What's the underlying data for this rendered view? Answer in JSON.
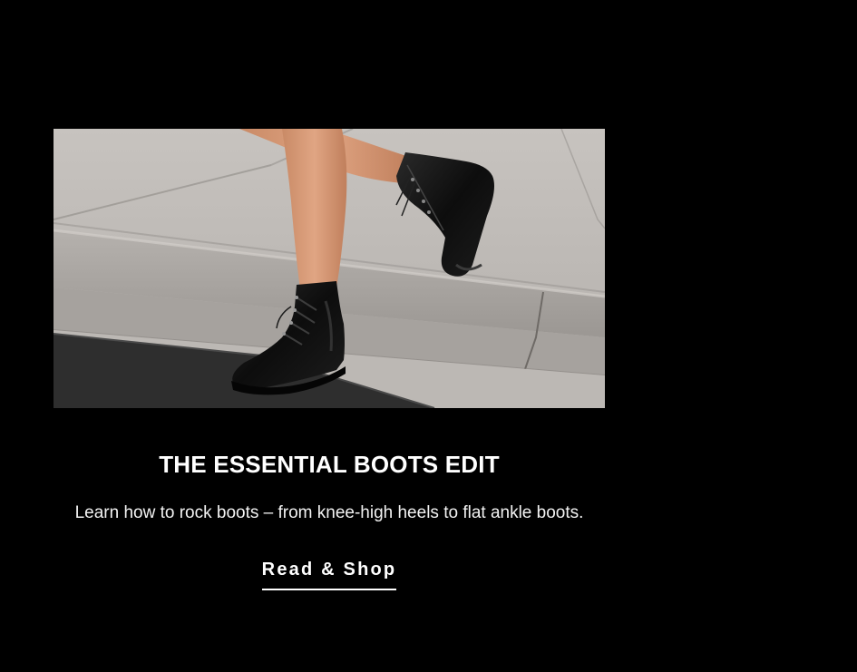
{
  "promo": {
    "image_alt": "Legs wearing black lace-up combat ankle boots stepping off a sidewalk curb",
    "title": "THE ESSENTIAL BOOTS EDIT",
    "description": "Learn how to rock boots – from knee-high heels to flat ankle boots.",
    "cta_label": "Read & Shop"
  },
  "colors": {
    "background": "#000000",
    "text": "#ffffff",
    "pavement": "#bdb9b5",
    "asphalt": "#2e2e2e",
    "boot": "#111111"
  }
}
